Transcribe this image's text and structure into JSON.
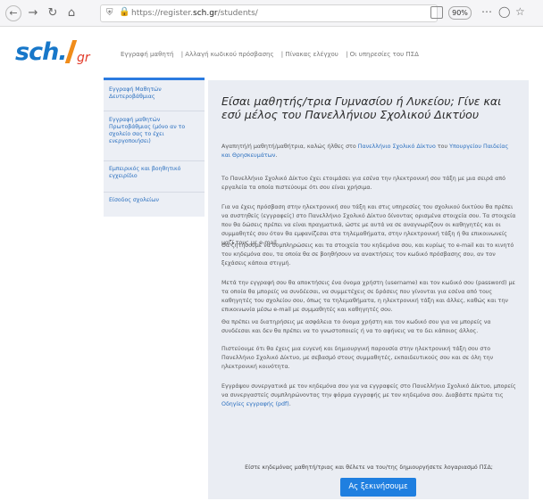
{
  "browser": {
    "url_prefix": "https://register.",
    "url_domain": "sch.gr",
    "url_path": "/students/",
    "zoom": "90%",
    "icons": {
      "back": "back-arrow-icon",
      "forward": "forward-arrow-icon",
      "reload": "reload-icon",
      "home": "home-icon",
      "shield": "shield-icon",
      "lock": "lock-icon",
      "reader": "reader-view-icon",
      "more": "more-icon",
      "pocket": "pocket-icon",
      "star": "star-icon"
    }
  },
  "site": {
    "logo_main": "sch.",
    "logo_suffix": "gr",
    "brand_color": "#1777c9",
    "accent_color": "#e23b2a",
    "topnav": [
      "Εγγραφή μαθητή",
      "| Αλλαγή κωδικού πρόσβασης",
      "| Πίνακας ελέγχου",
      "| Οι υπηρεσίες του ΠΣΔ"
    ]
  },
  "sidebar": {
    "items": [
      "Εγγραφή Μαθητών Δευτεροβάθμιας",
      "Εγγραφή μαθητών Πρωτοβάθμιας (μόνο αν το σχολείο σας το έχει ενεργοποιήσει)",
      "Εμπειρικός και βοηθητικό εγχειρίδιο",
      "Είσοδος σχολείων"
    ]
  },
  "main": {
    "title": "Είσαι μαθητής/τρια Γυμνασίου ή Λυκείου; Γίνε και εσύ μέλος του Πανελλήνιου Σχολικού Δικτύου",
    "p1_a": "Αγαπητή/ή μαθητή/μαθήτρια, καλώς ήλθες στο ",
    "p1_link1": "Πανελλήνιο Σχολικό Δίκτυο",
    "p1_b": " του ",
    "p1_link2": "Υπουργείου Παιδείας και Θρησκευμάτων",
    "p1_c": ".",
    "p2": "Το Πανελλήνιο Σχολικό Δίκτυο έχει ετοιμάσει για εσένα την ηλεκτρονική σου τάξη με μια σειρά από εργαλεία τα οποία πιστεύουμε ότι σου είναι χρήσιμα.",
    "p3": "Για να έχεις πρόσβαση στην ηλεκτρονική σου τάξη και στις υπηρεσίες του σχολικού δικτύου θα πρέπει να συστηθείς (εγγραφείς) στο Πανελλήνιο Σχολικό Δίκτυο δίνοντας ορισμένα στοιχεία σου. Τα στοιχεία που θα δώσεις πρέπει να είναι πραγματικά, ώστε με αυτά να σε αναγνωρίζουν οι καθηγητές και οι συμμαθητές σου όταν θα εμφανίζεσαι στα τηλεμαθήματα, στην ηλεκτρονική τάξη ή θα επικοινωνείς μαζί τους με e-mail.",
    "p4": "Θα ζητήσουμε να συμπληρώσεις και τα στοιχεία του κηδεμόνα σου, και κυρίως το e-mail και το κινητό του κηδεμόνα σου, τα οποία θα σε βοηθήσουν να ανακτήσεις τον κωδικό πρόσβασης σου, αν τον ξεχάσεις κάποια στιγμή.",
    "p5": "Μετά την εγγραφή σου θα αποκτήσεις ένα όνομα χρήστη (username) και τον κωδικό σου (password) με τα οποία θα μπορείς να συνδέεσαι, να συμμετέχεις σε δράσεις που γίνονται για εσένα από τους καθηγητές του σχολείου σου, όπως τα τηλεμαθήματα, η ηλεκτρονική τάξη και άλλες, καθώς και την επικοινωνία μέσω e-mail με συμμαθητές και καθηγητές σου.",
    "p6": "Θα πρέπει να διατηρήσεις με ασφάλεια το όνομα χρήστη και τον κωδικό σου για να μπορείς να συνδέεσαι και δεν θα πρέπει να το γνωστοποιείς ή να το αφήνεις να το δει κάποιος άλλος.",
    "p7": "Πιστεύουμε ότι θα έχεις μια ευγενή και δημιουργική παρουσία στην ηλεκτρονική τάξη σου στο Πανελλήνιο Σχολικό Δίκτυο, με σεβασμό στους συμμαθητές, εκπαιδευτικούς σου και σε όλη την ηλεκτρονική κοινότητα.",
    "p8_a": "Εγγράψου συνεργατικά με τον κηδεμόνα σου για να εγγραφείς στο Πανελλήνιο Σχολικό Δίκτυο, μπορείς να συνεργαστείς συμπληρώνοντας την φόρμα εγγραφής με τον κηδεμόνα σου. Διαβάστε πρώτα τις ",
    "p8_link": "Οδηγίες εγγραφής (pdf)",
    "p8_b": ".",
    "p9": "Είστε κηδεμόνας μαθητή/τριας και θέλετε να του/της δημιουργήσετε λογαριασμό ΠΣΔ;",
    "button_label": "Ας ξεκινήσουμε",
    "button_color": "#1f7fe0"
  }
}
